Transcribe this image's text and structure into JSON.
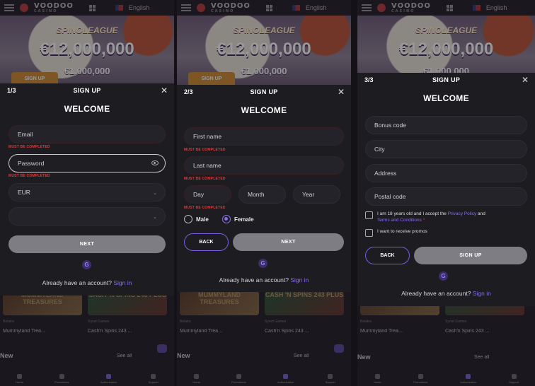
{
  "app": {
    "logo_text": "VOODOO",
    "logo_sub": "CASINO",
    "language": "English",
    "banner": {
      "title": "SPINOLEAGUE",
      "amount": "€12,000,000",
      "sub": "€1,000,000",
      "button": "SIGN UP"
    },
    "games": [
      {
        "tile_label": "MUMMYLAND TREASURES",
        "provider": "Belatra",
        "name": "Mummyland Trea..."
      },
      {
        "tile_label": "CASH 'N SPINS 243 PLUS",
        "provider": "Synot Games",
        "name": "Cash'n Spins 243 ..."
      }
    ],
    "section_new": "New",
    "see_all": "See all",
    "bottom_nav": [
      "Home",
      "Promotions",
      "Authorization",
      "Support"
    ]
  },
  "steps": [
    {
      "step": "1/3",
      "title": "SIGN UP",
      "welcome": "WELCOME",
      "email_placeholder": "Email",
      "password_placeholder": "Password",
      "currency": "EUR",
      "empty_select": "",
      "error": "MUST BE COMPLETED",
      "next": "NEXT",
      "google": "G",
      "account_text": "Already have an account?",
      "signin": "Sign in"
    },
    {
      "step": "2/3",
      "title": "SIGN UP",
      "welcome": "WELCOME",
      "first_name": "First name",
      "last_name": "Last name",
      "day": "Day",
      "month": "Month",
      "year": "Year",
      "error": "MUST BE COMPLETED",
      "male": "Male",
      "female": "Female",
      "back": "BACK",
      "next": "NEXT",
      "google": "G",
      "account_text": "Already have an account?",
      "signin": "Sign in"
    },
    {
      "step": "3/3",
      "title": "SIGN UP",
      "welcome": "WELCOME",
      "bonus_code": "Bonus code",
      "city": "City",
      "address": "Address",
      "postal_code": "Postal code",
      "age_text_1": "I am 18 years old and I accept the",
      "privacy_policy": "Privacy Policy",
      "and": "and",
      "terms": "Terms and Conditions",
      "required_mark": "*",
      "promos_text": "I want to receive promos",
      "back": "BACK",
      "sign_up": "SIGN UP",
      "google": "G",
      "account_text": "Already have an account?",
      "signin": "Sign in"
    }
  ]
}
